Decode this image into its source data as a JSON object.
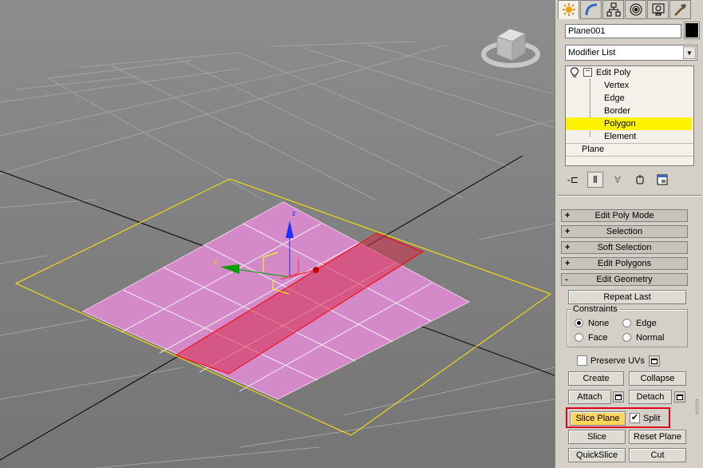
{
  "viewport": {
    "viewcube_icon": "viewcube-icon",
    "gizmo_axes": {
      "x": "x",
      "y": "y",
      "z": "z"
    }
  },
  "panel": {
    "tabs": [
      {
        "icon": "create-tab-icon",
        "active": true
      },
      {
        "icon": "modify-tab-icon"
      },
      {
        "icon": "hierarchy-tab-icon"
      },
      {
        "icon": "motion-tab-icon"
      },
      {
        "icon": "display-tab-icon"
      },
      {
        "icon": "utilities-tab-icon"
      }
    ],
    "object_name": "Plane001",
    "object_color": "#000000",
    "modifier_list": "Modifier List",
    "stack": {
      "edit_poly": "Edit Poly",
      "subobjects": [
        "Vertex",
        "Edge",
        "Border",
        "Polygon",
        "Element"
      ],
      "selected": "Polygon",
      "base": "Plane"
    },
    "rollouts": [
      {
        "sign": "+",
        "label": "Edit Poly Mode"
      },
      {
        "sign": "+",
        "label": "Selection"
      },
      {
        "sign": "+",
        "label": "Soft Selection"
      },
      {
        "sign": "+",
        "label": "Edit Polygons"
      },
      {
        "sign": "-",
        "label": "Edit Geometry"
      }
    ],
    "edit_geometry": {
      "repeat_last": "Repeat Last",
      "constraints_title": "Constraints",
      "constraints": {
        "none": "None",
        "edge": "Edge",
        "face": "Face",
        "normal": "Normal",
        "selected": "None"
      },
      "preserve_uvs": "Preserve UVs",
      "create": "Create",
      "collapse": "Collapse",
      "attach": "Attach",
      "detach": "Detach",
      "slice_plane": "Slice Plane",
      "split": "Split",
      "split_checked": true,
      "slice": "Slice",
      "reset_plane": "Reset Plane",
      "quickslice": "QuickSlice",
      "cut": "Cut"
    },
    "colors": {
      "selection": "#fff200",
      "slice_plane_button": "#fdd55c",
      "callout": "#e0001a"
    }
  }
}
